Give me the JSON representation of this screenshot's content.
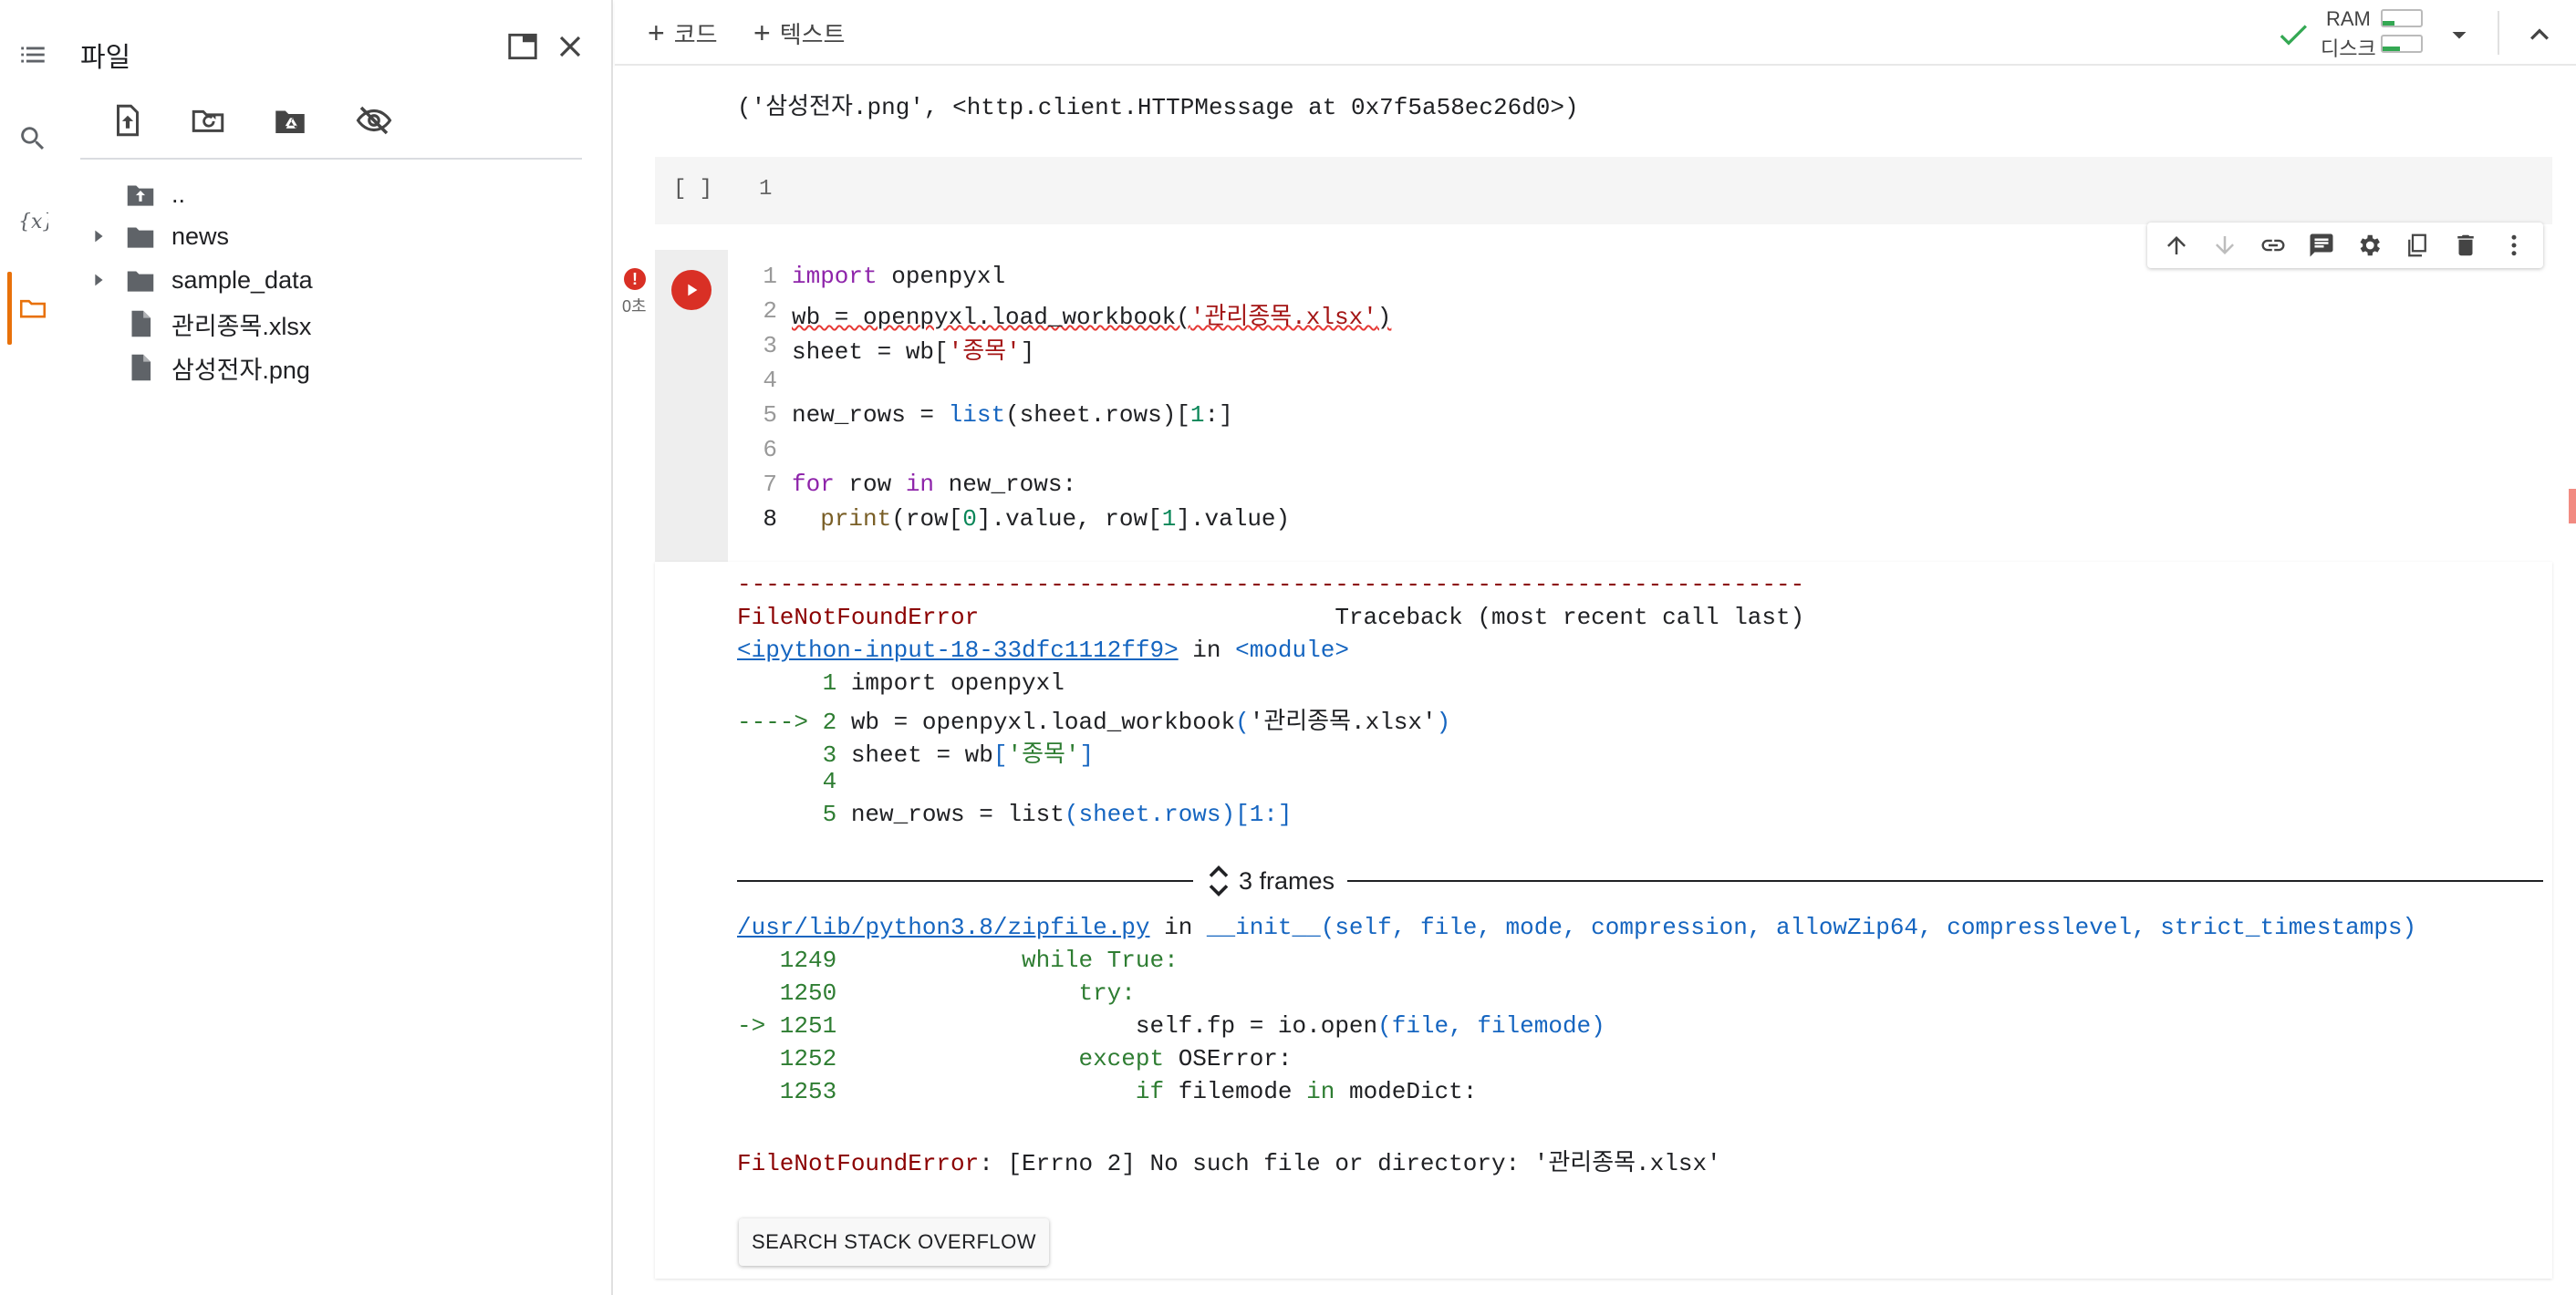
{
  "file_panel": {
    "title": "파일",
    "tree": [
      {
        "label": "..",
        "type": "up"
      },
      {
        "label": "news",
        "type": "folder"
      },
      {
        "label": "sample_data",
        "type": "folder"
      },
      {
        "label": "관리종목.xlsx",
        "type": "file"
      },
      {
        "label": "삼성전자.png",
        "type": "file"
      }
    ]
  },
  "toolbar": {
    "add_code": "코드",
    "add_text": "텍스트",
    "ram_label": "RAM",
    "disk_label": "디스크"
  },
  "prev_output": "('삼성전자.png', <http.client.HTTPMessage at 0x7f5a58ec26d0>)",
  "empty_cell": {
    "brackets": "[ ]",
    "line_number": "1"
  },
  "cell": {
    "exec_time": "0초",
    "error_badge": "!",
    "line_numbers": [
      "1",
      "2",
      "3",
      "4",
      "5",
      "6",
      "7",
      "8"
    ],
    "code": {
      "l1_kw": "import",
      "l1_rest": " openpyxl",
      "l2_pre": "wb = openpyxl.load_workbook(",
      "l2_str": "'관리종목.xlsx'",
      "l2_post": ")",
      "l3_pre": "sheet = wb[",
      "l3_str": "'종목'",
      "l3_post": "]",
      "l5_pre": "new_rows = ",
      "l5_bi": "list",
      "l5_mid": "(sheet.rows)[",
      "l5_num": "1",
      "l5_post": ":]",
      "l7_kw1": "for",
      "l7_mid": " row ",
      "l7_kw2": "in",
      "l7_post": " new_rows:",
      "l8_fn": "print",
      "l8_a": "(row[",
      "l8_n0": "0",
      "l8_b": "].value, row[",
      "l8_n1": "1",
      "l8_c": "].value)"
    }
  },
  "output": {
    "separator": "---------------------------------------------------------------------------",
    "error_name": "FileNotFoundError",
    "traceback_title": "Traceback (most recent call last)",
    "input_link": "<ipython-input-18-33dfc1112ff9>",
    "in_word": " in ",
    "module_text": "<module>",
    "tb1": {
      "l1_num": "      1 ",
      "l1_code": "import openpyxl",
      "l2_arrow": "----> 2 ",
      "l2_code_a": "wb = openpyxl.load_workbook",
      "l2_code_b": "(",
      "l2_code_str": "'관리종목.xlsx'",
      "l2_code_c": ")",
      "l3_num": "      3 ",
      "l3_code_a": "sheet = wb",
      "l3_code_b": "[",
      "l3_code_str": "'종목'",
      "l3_code_c": "]",
      "l4_num": "      4 ",
      "l5_num": "      5 ",
      "l5_code_a": "new_rows = list",
      "l5_code_b": "(sheet.rows)[1:]"
    },
    "frames_label": "3 frames",
    "zip_link": "/usr/lib/python3.8/zipfile.py",
    "init_sig": "__init__(self, file, mode, compression, allowZip64, compresslevel, strict_timestamps)",
    "tb2": {
      "n1249": "   1249 ",
      "c1249": "            while True:",
      "n1250": "   1250 ",
      "c1250": "                try:",
      "arrow1251": "-> 1251 ",
      "c1251_a": "                    self.fp = io.open",
      "c1251_b": "(file, filemode)",
      "n1252": "   1252 ",
      "c1252_a": "                ",
      "c1252_kw": "except",
      "c1252_b": " OSError:",
      "n1253": "   1253 ",
      "c1253_a": "                    ",
      "c1253_kw": "if",
      "c1253_b": " filemode ",
      "c1253_kw2": "in",
      "c1253_c": " modeDict:"
    },
    "final_error_name": "FileNotFoundError",
    "final_error_msg": ": [Errno 2] No such file or directory: '관리종목.xlsx'",
    "so_button": "SEARCH STACK OVERFLOW"
  },
  "colors": {
    "accent_orange": "#e8710a",
    "error_red": "#d93025",
    "ok_green": "#34a853"
  }
}
